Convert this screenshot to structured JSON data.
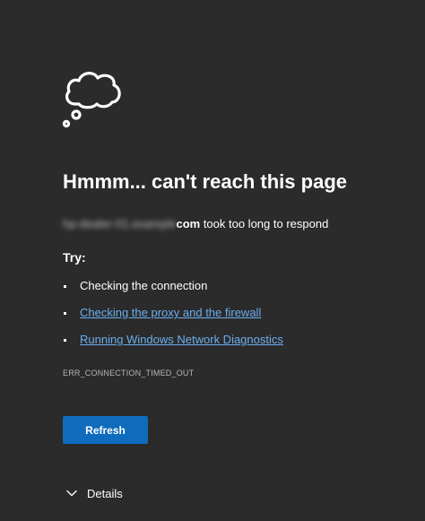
{
  "error_page": {
    "icon": "cloud-thought-icon",
    "headline": "Hmmm... can't reach this page",
    "message": {
      "host_blurred": "hp-dealer-01.example",
      "host_tld": "com",
      "suffix": " took too long to respond"
    },
    "try_label": "Try:",
    "suggestions": [
      {
        "label": "Checking the connection",
        "is_link": false
      },
      {
        "label": "Checking the proxy and the firewall",
        "is_link": true
      },
      {
        "label": "Running Windows Network Diagnostics",
        "is_link": true
      }
    ],
    "error_code": "ERR_CONNECTION_TIMED_OUT",
    "refresh_label": "Refresh",
    "details_label": "Details"
  },
  "colors": {
    "background": "#2b2b2b",
    "text": "#ffffff",
    "link": "#6aaeef",
    "button": "#0f6cbd",
    "muted": "#b5b5b5"
  }
}
